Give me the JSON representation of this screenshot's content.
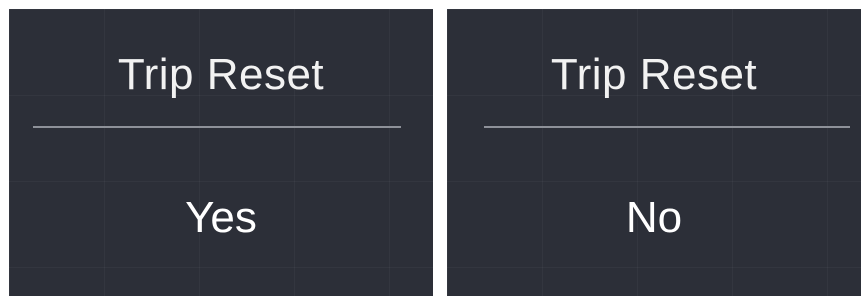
{
  "screens": [
    {
      "title": "Trip Reset",
      "value": "Yes"
    },
    {
      "title": "Trip Reset",
      "value": "No"
    }
  ],
  "colors": {
    "panel_background": "#2c2f38",
    "text": "#f2f2f2",
    "divider": "#8e9199"
  }
}
